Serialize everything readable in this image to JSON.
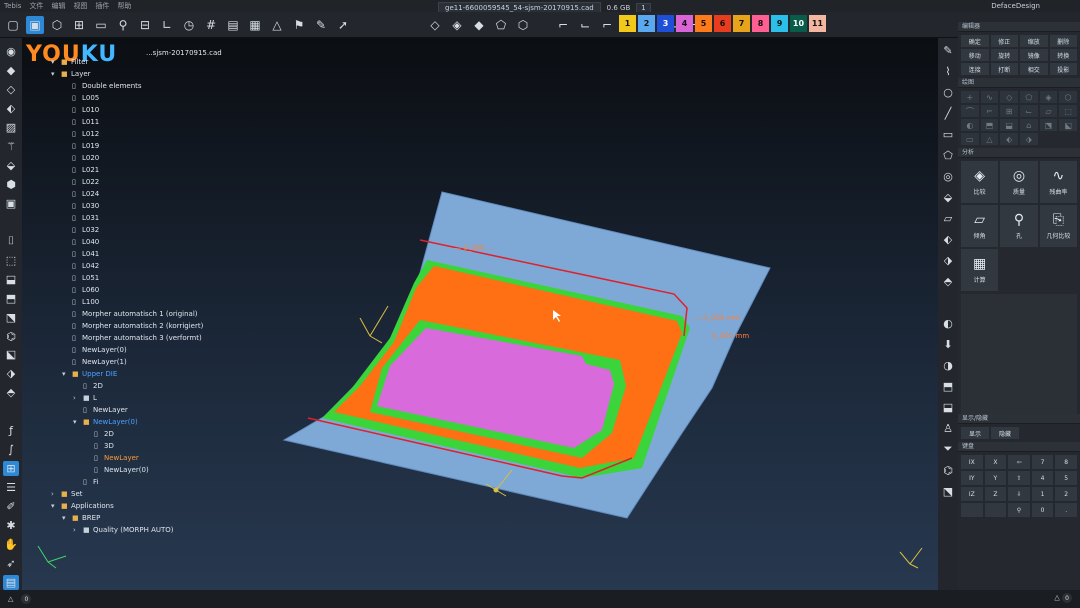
{
  "menu": [
    "Tebis",
    "文件",
    "编辑",
    "视图",
    "插件",
    "帮助"
  ],
  "title": {
    "file": "ge11-6600059545_54-sjsm-20170915.cad",
    "size": "0.6 GB",
    "page": "1"
  },
  "brand": "DefaceDesign",
  "logo": {
    "you": "YOU",
    "ku": "KU"
  },
  "swatches": [
    {
      "n": "1",
      "c": "#f2c81a"
    },
    {
      "n": "2",
      "c": "#5aa9f0"
    },
    {
      "n": "3",
      "c": "#1e4fd6"
    },
    {
      "n": "4",
      "c": "#d864d6"
    },
    {
      "n": "5",
      "c": "#ff7a1a"
    },
    {
      "n": "6",
      "c": "#e83c1e"
    },
    {
      "n": "7",
      "c": "#e7a41a"
    },
    {
      "n": "8",
      "c": "#ff5f93"
    },
    {
      "n": "9",
      "c": "#2ac0e8"
    },
    {
      "n": "10",
      "c": "#0a5c4a"
    },
    {
      "n": "11",
      "c": "#f3b6a0"
    }
  ],
  "viewport_filename": "...sjsm-20170915.cad",
  "tree": [
    {
      "t": "Filter",
      "lvl": 1,
      "ic": "▾"
    },
    {
      "t": "Layer",
      "lvl": 1,
      "ic": "▾"
    },
    {
      "t": "Double elements",
      "lvl": 2
    },
    {
      "t": "L005",
      "lvl": 2
    },
    {
      "t": "L010",
      "lvl": 2
    },
    {
      "t": "L011",
      "lvl": 2
    },
    {
      "t": "L012",
      "lvl": 2
    },
    {
      "t": "L019",
      "lvl": 2
    },
    {
      "t": "L020",
      "lvl": 2
    },
    {
      "t": "L021",
      "lvl": 2
    },
    {
      "t": "L022",
      "lvl": 2
    },
    {
      "t": "L024",
      "lvl": 2
    },
    {
      "t": "L030",
      "lvl": 2
    },
    {
      "t": "L031",
      "lvl": 2
    },
    {
      "t": "L032",
      "lvl": 2
    },
    {
      "t": "L040",
      "lvl": 2
    },
    {
      "t": "L041",
      "lvl": 2
    },
    {
      "t": "L042",
      "lvl": 2
    },
    {
      "t": "L051",
      "lvl": 2
    },
    {
      "t": "L060",
      "lvl": 2
    },
    {
      "t": "L100",
      "lvl": 2
    },
    {
      "t": "Morpher automatisch 1 (original)",
      "lvl": 2
    },
    {
      "t": "Morpher automatisch 2 (korrigiert)",
      "lvl": 2
    },
    {
      "t": "Morpher automatisch 3 (verformt)",
      "lvl": 2
    },
    {
      "t": "NewLayer(0)",
      "lvl": 2
    },
    {
      "t": "NewLayer(1)",
      "lvl": 2
    },
    {
      "t": "Upper DIE",
      "lvl": 2,
      "ic": "▾",
      "blue": true
    },
    {
      "t": "2D",
      "lvl": 3
    },
    {
      "t": "L",
      "lvl": 3,
      "ic": "›"
    },
    {
      "t": "NewLayer",
      "lvl": 3
    },
    {
      "t": "NewLayer(0)",
      "lvl": 3,
      "ic": "▾",
      "blue": true
    },
    {
      "t": "2D",
      "lvl": 4
    },
    {
      "t": "3D",
      "lvl": 4
    },
    {
      "t": "NewLayer",
      "lvl": 4,
      "hl": true
    },
    {
      "t": "NewLayer(0)",
      "lvl": 4
    },
    {
      "t": "Fi",
      "lvl": 3
    },
    {
      "t": "Set",
      "lvl": 1,
      "ic": "›"
    },
    {
      "t": "Applications",
      "lvl": 1,
      "ic": "▾"
    },
    {
      "t": "BREP",
      "lvl": 2,
      "ic": "▾"
    },
    {
      "t": "Quality (MORPH AUTO)",
      "lvl": 3,
      "ic": "›"
    }
  ],
  "annotations": [
    "— 0_000 ...",
    "... 0_000 mm",
    "0_000 mm"
  ],
  "panel": {
    "edit_head": "编辑器",
    "edit_cells": [
      "确定",
      "修正",
      "缩放",
      "删除",
      "移动",
      "旋转",
      "镜像",
      "转换",
      "连接",
      "打断",
      "相交",
      "投影"
    ],
    "draw_head": "绘图",
    "analysis_head": "分析",
    "analysis_items": [
      {
        "label": "比较",
        "icon": "◈"
      },
      {
        "label": "质量",
        "icon": "◎"
      },
      {
        "label": "残曲率",
        "icon": "∿"
      },
      {
        "label": "倾角",
        "icon": "▱"
      },
      {
        "label": "孔",
        "icon": "⚲"
      },
      {
        "label": "几何比较",
        "icon": "⎘"
      },
      {
        "label": "计算",
        "icon": "▦"
      }
    ],
    "showhide_head": "显示/隐藏",
    "show": "显示",
    "hide": "隐藏",
    "keys_head": "键盘",
    "keys": [
      "IX",
      "X",
      "⇦",
      "7",
      "8",
      "IY",
      "Y",
      "⇧",
      "4",
      "5",
      "IZ",
      "Z",
      "⇩",
      "1",
      "2",
      "",
      "",
      "⚲",
      "0",
      "."
    ]
  },
  "status": {
    "left": "0",
    "right": "0"
  }
}
